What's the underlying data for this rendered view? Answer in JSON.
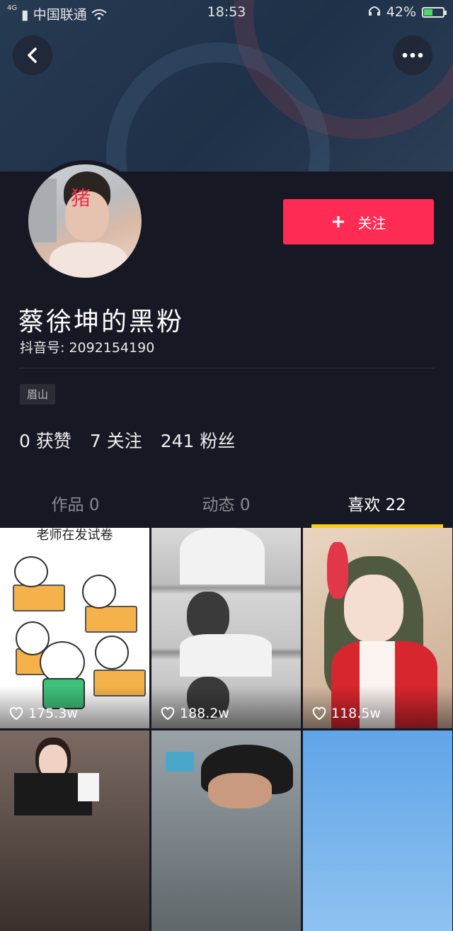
{
  "status_bar": {
    "carrier": "中国联通",
    "time": "18:53",
    "battery_percent": "42%",
    "battery_level": 0.42
  },
  "profile": {
    "avatar_overlay_text": "猪",
    "follow_label": "关注",
    "name": "蔡徐坤的黑粉",
    "douyin_id": "抖音号: 2092154190",
    "location_tag": "眉山",
    "stats": {
      "likes": "0 获赞",
      "following": "7 关注",
      "followers": "241 粉丝"
    }
  },
  "tabs": [
    {
      "label": "作品 0",
      "active": false
    },
    {
      "label": "动态 0",
      "active": false
    },
    {
      "label": "喜欢 22",
      "active": true
    }
  ],
  "grid": [
    {
      "caption": "老师在发试卷",
      "likes": "175.3w"
    },
    {
      "caption": "",
      "likes": "188.2w"
    },
    {
      "caption": "",
      "likes": "118.5w"
    },
    {
      "caption": "",
      "likes": ""
    },
    {
      "caption": "",
      "likes": ""
    },
    {
      "caption": "",
      "likes": ""
    }
  ],
  "colors": {
    "accent": "#fe2c55",
    "tab_indicator": "#face15",
    "background": "#161823"
  }
}
